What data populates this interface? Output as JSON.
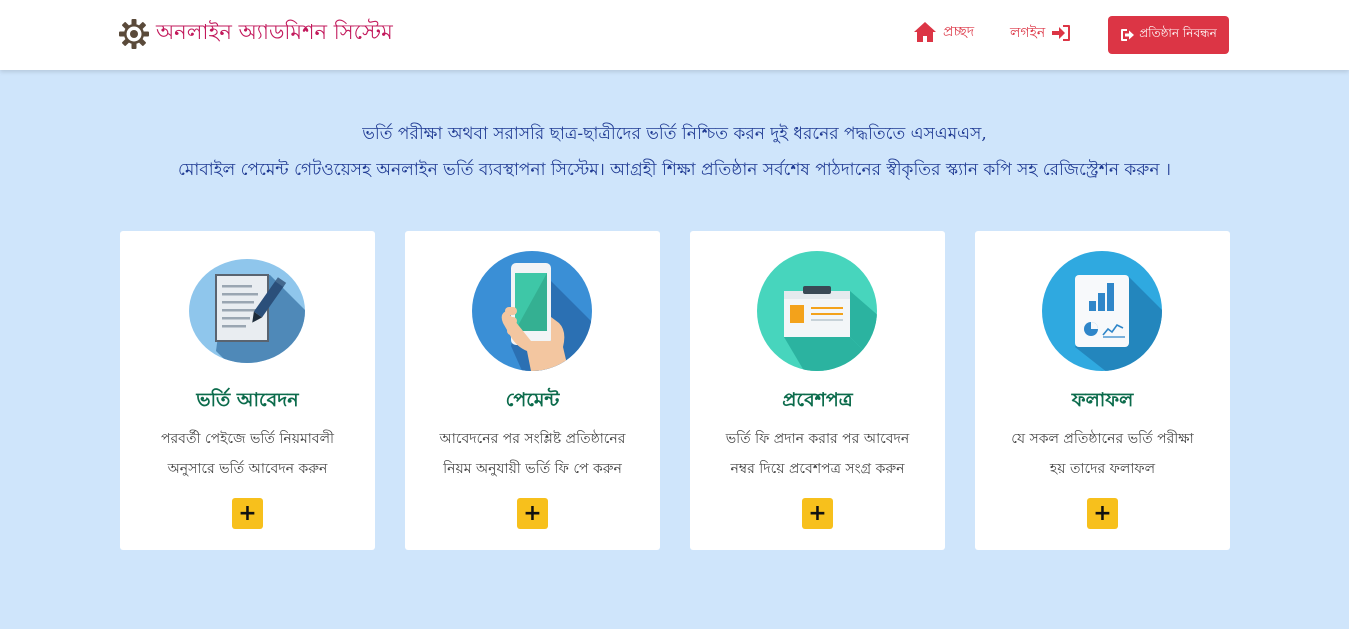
{
  "header": {
    "brand_title": "অনলাইন অ্যাডমিশন সিস্টেম",
    "nav": {
      "home_label": "প্রচ্ছদ",
      "login_label": "লগইন",
      "register_label": "প্রতিষ্ঠান নিবন্ধন"
    }
  },
  "intro": {
    "line1": "ভর্তি পরীক্ষা অথবা সরাসরি ছাত্র-ছাত্রীদের ভর্তি নিশ্চিত করন দুই ধরনের পদ্ধতিতে এসএমএস,",
    "line2": "মোবাইল পেমেন্ট গেটওয়েসহ অনলাইন ভর্তি ব্যবস্থাপনা সিস্টেম। আগ্রহী শিক্ষা প্রতিষ্ঠান সর্বশেষ পাঠদানের স্বীকৃতির স্ক্যান কপি সহ রেজিস্ট্রেশন করুন ।"
  },
  "cards": [
    {
      "title": "ভর্তি আবেদন",
      "desc1": "পরবর্তী পেইজে ভর্তি নিয়মাবলী",
      "desc2": "অনুসারে ভর্তি আবেদন করুন",
      "button": "+",
      "icon": "form-pen-icon"
    },
    {
      "title": "পেমেন্ট",
      "desc1": "আবেদনের পর সংশ্লিষ্ট প্রতিষ্ঠানের",
      "desc2": "নিয়ম অনুযায়ী ভর্তি ফি পে করুন",
      "button": "+",
      "icon": "mobile-phone-icon"
    },
    {
      "title": "প্রবেশপত্র",
      "desc1": "ভর্তি ফি প্রদান করার পর আবেদন",
      "desc2": "নম্বর দিয়ে প্রবেশপত্র সংগ্র করুন",
      "button": "+",
      "icon": "id-card-icon"
    },
    {
      "title": "ফলাফল",
      "desc1": "যে সকল প্রতিষ্ঠানের ভর্তি পরীক্ষা",
      "desc2": "হয় তাদের ফলাফল",
      "button": "+",
      "icon": "result-chart-icon"
    }
  ],
  "colors": {
    "page_background": "#cfe5fb",
    "brand_text": "#c2185b",
    "nav_accent": "#dc3545",
    "intro_text": "#1f3a93",
    "card_title": "#0b6b4b",
    "plus_button": "#f7c01c"
  }
}
